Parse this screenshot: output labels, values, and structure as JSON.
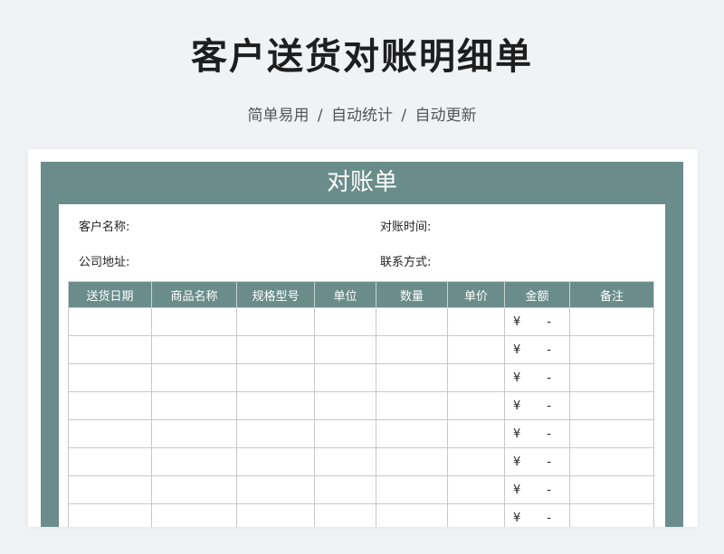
{
  "header": {
    "title": "客户送货对账明细单",
    "subtitle": "简单易用 / 自动统计 / 自动更新"
  },
  "sheet": {
    "title": "对账单",
    "info": {
      "customer_name_label": "客户名称:",
      "statement_time_label": "对账时间:",
      "company_address_label": "公司地址:",
      "contact_label": "联系方式:"
    },
    "table": {
      "columns": [
        "送货日期",
        "商品名称",
        "规格型号",
        "单位",
        "数量",
        "单价",
        "金额",
        "备注"
      ],
      "amount_currency": "¥",
      "amount_placeholder": "-",
      "rows": [
        {
          "date": "",
          "product": "",
          "spec": "",
          "unit": "",
          "qty": "",
          "price": "",
          "amount": "-",
          "note": ""
        },
        {
          "date": "",
          "product": "",
          "spec": "",
          "unit": "",
          "qty": "",
          "price": "",
          "amount": "-",
          "note": ""
        },
        {
          "date": "",
          "product": "",
          "spec": "",
          "unit": "",
          "qty": "",
          "price": "",
          "amount": "-",
          "note": ""
        },
        {
          "date": "",
          "product": "",
          "spec": "",
          "unit": "",
          "qty": "",
          "price": "",
          "amount": "-",
          "note": ""
        },
        {
          "date": "",
          "product": "",
          "spec": "",
          "unit": "",
          "qty": "",
          "price": "",
          "amount": "-",
          "note": ""
        },
        {
          "date": "",
          "product": "",
          "spec": "",
          "unit": "",
          "qty": "",
          "price": "",
          "amount": "-",
          "note": ""
        },
        {
          "date": "",
          "product": "",
          "spec": "",
          "unit": "",
          "qty": "",
          "price": "",
          "amount": "-",
          "note": ""
        },
        {
          "date": "",
          "product": "",
          "spec": "",
          "unit": "",
          "qty": "",
          "price": "",
          "amount": "-",
          "note": ""
        }
      ]
    }
  },
  "colors": {
    "accent": "#6a8d8c",
    "background": "#f1f2f4"
  }
}
